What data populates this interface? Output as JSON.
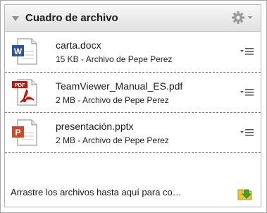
{
  "widget": {
    "title": "Cuadro de archivo",
    "gear_icon": "gear-icon",
    "collapse_icon": "triangle-down-icon"
  },
  "files": [
    {
      "name": "carta.docx",
      "meta": "15 KB - Archivo de Pepe Perez",
      "icon": "word-document-icon",
      "letter": "W"
    },
    {
      "name": "TeamViewer_Manual_ES.pdf",
      "meta": "2 MB - Archivo de Pepe Perez",
      "icon": "pdf-document-icon",
      "letter": "PDF"
    },
    {
      "name": "presentación.pptx",
      "meta": "2 MB - Archivo de Pepe Perez",
      "icon": "powerpoint-document-icon",
      "letter": "P"
    }
  ],
  "footer": {
    "drop_text": "Arrastre los archivos hasta aquí para co…",
    "upload_icon": "folder-upload-icon"
  },
  "colors": {
    "word": "#2b5797",
    "pdf": "#c0170d",
    "powerpoint": "#d24726",
    "folder": "#e8c53a",
    "arrow": "#3aa533"
  }
}
